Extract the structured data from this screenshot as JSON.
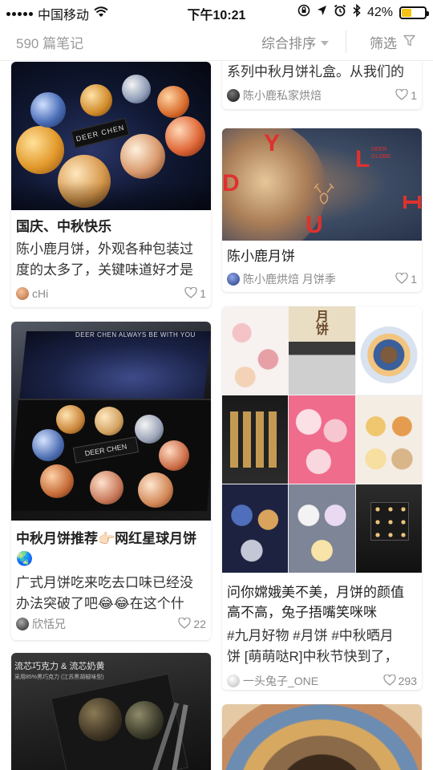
{
  "status_bar": {
    "carrier": "中国移动",
    "time": "下午10:21",
    "battery": "42%",
    "battery_level": 0.42,
    "icons": [
      "signal-icon",
      "wifi-icon",
      "orientation-lock-icon",
      "location-icon",
      "alarm-icon",
      "bluetooth-icon",
      "battery-icon"
    ]
  },
  "header": {
    "note_count": "590 篇笔记",
    "sort_label": "综合排序",
    "filter_label": "筛选"
  },
  "colors": {
    "accent_red": "#e0312e",
    "text_gray": "#8a8a8a",
    "battery_yellow": "#f4c216"
  },
  "left_column": [
    {
      "title": "国庆、中秋快乐",
      "desc_lines": [
        "陈小鹿月饼，外观各种包装过",
        "度的太多了，关键味道好才是"
      ],
      "image_text": "DEER CHEN",
      "author": "cHi",
      "likes": "1"
    },
    {
      "title_lines": [
        "中秋月饼推荐👉🏻网红星球月饼",
        "🌏"
      ],
      "desc_lines": [
        "广式月饼吃来吃去口味已经没",
        "办法突破了吧😂😂在这个什"
      ],
      "image_text_top": "DEER CHEN ALWAYS BE WITH YOU",
      "image_text_box": "DEER CHEN",
      "author": "欣恬兄",
      "likes": "22"
    },
    {
      "image_text_lines": [
        "流芯巧克力 & 流芯奶黄",
        "采用85%黑巧克力 (江苏黑胡椒味型)"
      ]
    }
  ],
  "right_column": [
    {
      "desc_lines": [
        "系列中秋月饼礼盒。从我们的"
      ],
      "author": "陈小鹿私家烘焙",
      "likes": "1"
    },
    {
      "title": "陈小鹿月饼",
      "image_letters": [
        "Y",
        "L",
        "D",
        "U"
      ],
      "image_text_lines": [
        "DEER",
        "GLOBE"
      ],
      "author": "陈小鹿烘焙  月饼季",
      "likes": "1"
    },
    {
      "title_lines": [
        "问你嫦娥美不美，月饼的颜值",
        "高不高，兔子捂嘴笑咪咪"
      ],
      "desc_lines": [
        "#九月好物  #月饼  #中秋晒月",
        "饼  [萌萌哒R]中秋节快到了，"
      ],
      "collage_text": "月饼",
      "author": "一头兔子_ONE",
      "likes": "293"
    }
  ]
}
